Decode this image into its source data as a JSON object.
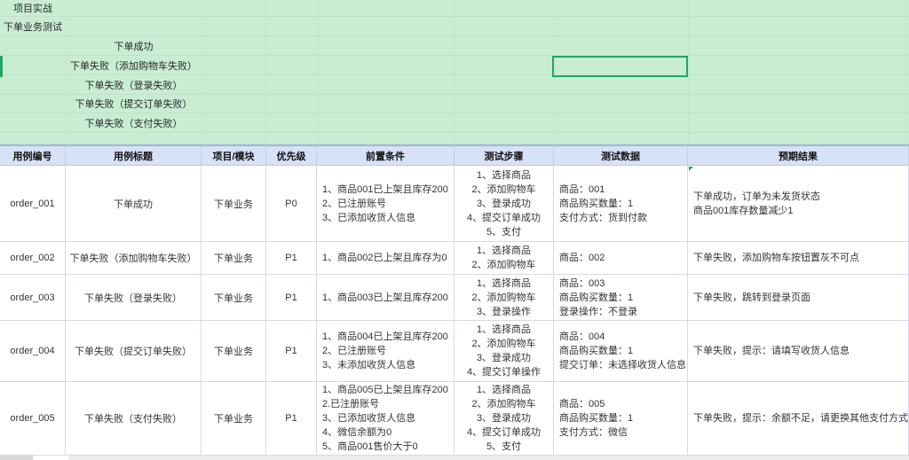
{
  "colors": {
    "sheet_green_fill": "#c8edd3",
    "selection_green": "#22a565",
    "header_blue_fill": "#d8e2f6",
    "gridline_table": "#d4dae6",
    "gridline_green": "#c2e0cb",
    "comment_marker_green": "#28a05b"
  },
  "outline": {
    "rows": [
      {
        "text": "项目实战"
      },
      {
        "text": "下单业务测试"
      },
      {
        "text": "下单成功"
      },
      {
        "text": "下单失败（添加购物车失败）"
      },
      {
        "text": "下单失败（登录失败）"
      },
      {
        "text": "下单失败（提交订单失败）"
      },
      {
        "text": "下单失败（支付失败）"
      },
      {
        "text": ""
      }
    ]
  },
  "selection": {
    "selected_row_label": "下单失败（添加购物车失败）",
    "selected_column_label": "测试数据"
  },
  "testcase_table": {
    "headers": [
      "用例编号",
      "用例标题",
      "项目/模块",
      "优先级",
      "前置条件",
      "测试步骤",
      "测试数据",
      "预期结果"
    ],
    "rows": [
      {
        "id": "order_001",
        "title": "下单成功",
        "module": "下单业务",
        "priority": "P0",
        "preconditions": "1、商品001已上架且库存200\n2、已注册账号\n3、已添加收货人信息",
        "steps": "1、选择商品\n2、添加购物车\n3、登录成功\n4、提交订单成功\n5、支付",
        "test_data": "商品：001\n商品购买数量：1\n支付方式：货到付款",
        "expected": "下单成功，订单为未发货状态\n商品001库存数量减少1",
        "corner_marker": true
      },
      {
        "id": "order_002",
        "title": "下单失败（添加购物车失败）",
        "module": "下单业务",
        "priority": "P1",
        "preconditions": "1、商品002已上架且库存为0",
        "steps": "1、选择商品\n2、添加购物车",
        "test_data": "商品：002",
        "expected": "下单失败，添加购物车按钮置灰不可点",
        "corner_marker": false
      },
      {
        "id": "order_003",
        "title": "下单失败（登录失败）",
        "module": "下单业务",
        "priority": "P1",
        "preconditions": "1、商品003已上架且库存200",
        "steps": "1、选择商品\n2、添加购物车\n3、登录操作",
        "test_data": "商品：003\n商品购买数量：1\n登录操作：不登录",
        "expected": "下单失败，跳转到登录页面",
        "corner_marker": false
      },
      {
        "id": "order_004",
        "title": "下单失败（提交订单失败）",
        "module": "下单业务",
        "priority": "P1",
        "preconditions": "1、商品004已上架且库存200\n2、已注册账号\n3、未添加收货人信息",
        "steps": "1、选择商品\n2、添加购物车\n3、登录成功\n4、提交订单操作",
        "test_data": "商品：004\n商品购买数量：1\n提交订单：未选择收货人信息",
        "expected": "下单失败，提示：请填写收货人信息",
        "corner_marker": false
      },
      {
        "id": "order_005",
        "title": "下单失败（支付失败）",
        "module": "下单业务",
        "priority": "P1",
        "preconditions": "1、商品005已上架且库存200\n2.已注册账号\n3、已添加收货人信息\n4、微信余额为0\n5、商品001售价大于0",
        "steps": "1、选择商品\n2、添加购物车\n3、登录成功\n4、提交订单成功\n5、支付",
        "test_data": "商品：005\n商品购买数量：1\n支付方式：微信",
        "expected": "下单失败，提示：余额不足，请更换其他支付方式",
        "corner_marker": false
      }
    ]
  }
}
